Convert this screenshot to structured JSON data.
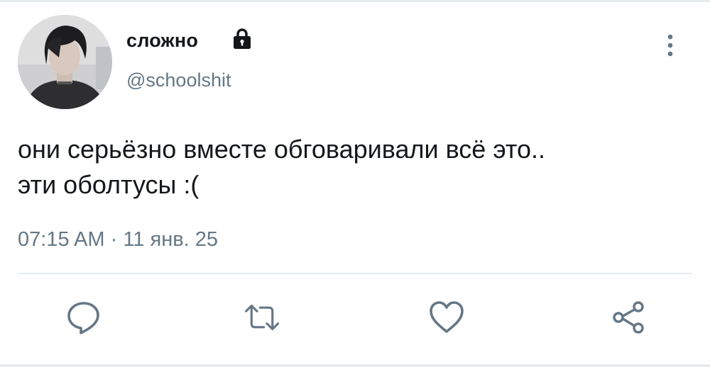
{
  "author": {
    "display_name": "сложно",
    "handle": "@schoolshit",
    "avatar_icon": "avatar",
    "protected_icon": "lock-icon"
  },
  "tweet": {
    "text": "они серьёзно вместе обговаривали всё это..\nэти оболтусы :(",
    "time": "07:15 AM",
    "separator": "·",
    "date": "11 янв. 25"
  },
  "actions": [
    {
      "icon": "reply-icon"
    },
    {
      "icon": "retweet-icon"
    },
    {
      "icon": "like-icon"
    },
    {
      "icon": "share-icon"
    }
  ],
  "colors": {
    "text_primary": "#14171a",
    "text_secondary": "#657786",
    "icon_gray": "#657786",
    "divider": "#e6ecf0"
  }
}
